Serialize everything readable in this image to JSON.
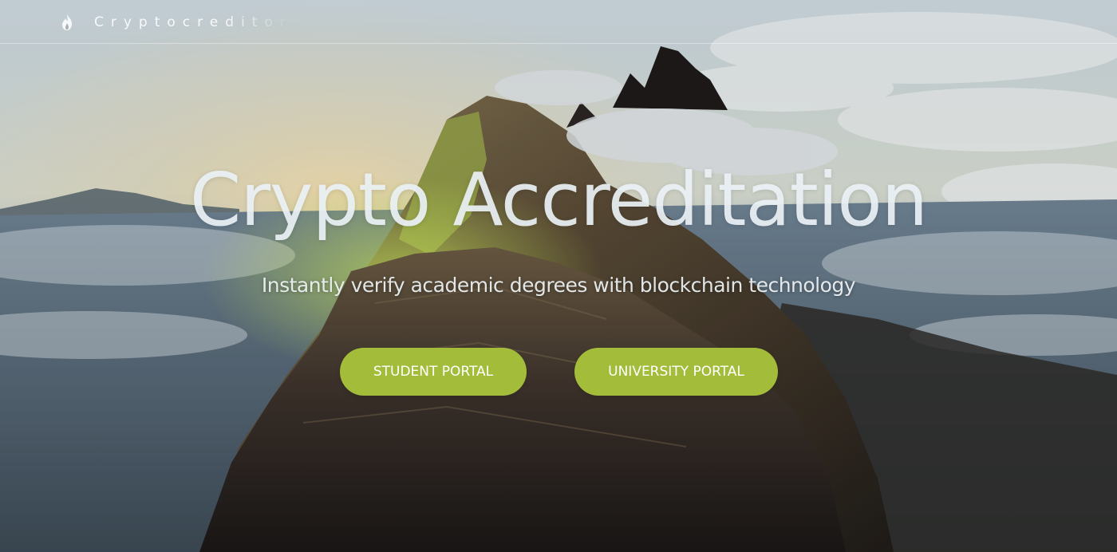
{
  "brand": {
    "name": "Cryptocreditor",
    "icon": "flame-logo-icon"
  },
  "hero": {
    "title": "Crypto Accreditation",
    "subtitle": "Instantly verify academic degrees with blockchain technology"
  },
  "buttons": {
    "student_label": "STUDENT PORTAL",
    "university_label": "UNIVERSITY PORTAL"
  },
  "colors": {
    "accent": "#a3bd3b",
    "title_text": "#ecf2f6",
    "nav_text": "#ffffff"
  }
}
